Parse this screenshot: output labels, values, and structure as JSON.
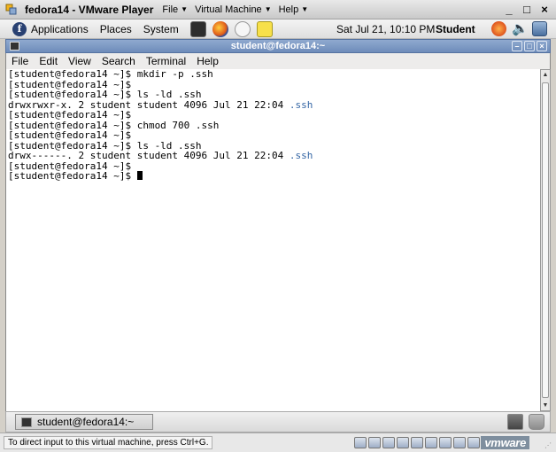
{
  "vmware": {
    "title": "fedora14 - VMware Player",
    "menus": [
      "File",
      "Virtual Machine",
      "Help"
    ],
    "window_controls": [
      "_",
      "□",
      "×"
    ]
  },
  "gnome_panel": {
    "menus": [
      "Applications",
      "Places",
      "System"
    ],
    "clock": "Sat Jul 21, 10:10 PM",
    "user": "Student"
  },
  "terminal": {
    "title": "student@fedora14:~",
    "menus": [
      "File",
      "Edit",
      "View",
      "Search",
      "Terminal",
      "Help"
    ],
    "lines": [
      {
        "text": "[student@fedora14 ~]$ mkdir -p .ssh",
        "dir": ""
      },
      {
        "text": "[student@fedora14 ~]$",
        "dir": ""
      },
      {
        "text": "[student@fedora14 ~]$ ls -ld .ssh",
        "dir": ""
      },
      {
        "text": "drwxrwxr-x. 2 student student 4096 Jul 21 22:04 ",
        "dir": ".ssh"
      },
      {
        "text": "[student@fedora14 ~]$",
        "dir": ""
      },
      {
        "text": "[student@fedora14 ~]$ chmod 700 .ssh",
        "dir": ""
      },
      {
        "text": "[student@fedora14 ~]$",
        "dir": ""
      },
      {
        "text": "[student@fedora14 ~]$ ls -ld .ssh",
        "dir": ""
      },
      {
        "text": "drwx------. 2 student student 4096 Jul 21 22:04 ",
        "dir": ".ssh"
      },
      {
        "text": "[student@fedora14 ~]$",
        "dir": ""
      },
      {
        "text": "[student@fedora14 ~]$ ",
        "dir": "",
        "cursor": true
      }
    ]
  },
  "taskbar": {
    "task_label": "student@fedora14:~"
  },
  "statusbar": {
    "hint": "To direct input to this virtual machine, press Ctrl+G.",
    "brand": "vmware"
  }
}
